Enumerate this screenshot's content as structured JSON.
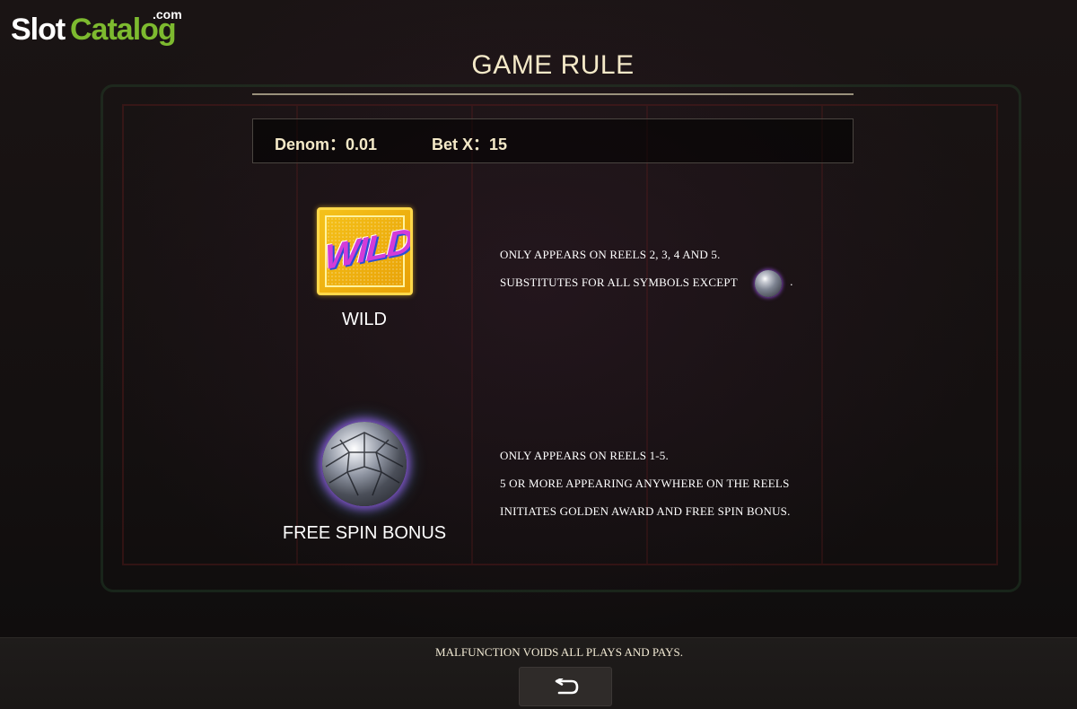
{
  "logo": {
    "part1": "Slot",
    "part2": "Catalog",
    "suffix": ".com"
  },
  "title": "GAME RULE",
  "info": {
    "denom_label": "Denom：",
    "denom_value": "0.01",
    "betx_label": "Bet X：",
    "betx_value": "15"
  },
  "symbols": [
    {
      "name": "WILD",
      "icon": "wild-symbol-icon",
      "lines": [
        "ONLY APPEARS ON REELS 2, 3, 4 AND 5.",
        "SUBSTITUTES FOR ALL SYMBOLS EXCEPT"
      ],
      "symbol_text": "WILD",
      "exception_icon": "disco-ball-icon",
      "trailing": "."
    },
    {
      "name": "FREE SPIN BONUS",
      "icon": "disco-ball-icon",
      "lines": [
        "ONLY APPEARS ON REELS 1-5.",
        "5 OR MORE APPEARING ANYWHERE ON THE REELS",
        "INITIATES GOLDEN AWARD AND FREE SPIN BONUS."
      ]
    }
  ],
  "footer": {
    "notice": "MALFUNCTION VOIDS ALL PLAYS AND PAYS.",
    "back_icon": "return-arrow-icon"
  },
  "colors": {
    "accent_text": "#f4e9c8",
    "logo_green": "#7dba2f",
    "wild_gold": "#f5c21a"
  }
}
